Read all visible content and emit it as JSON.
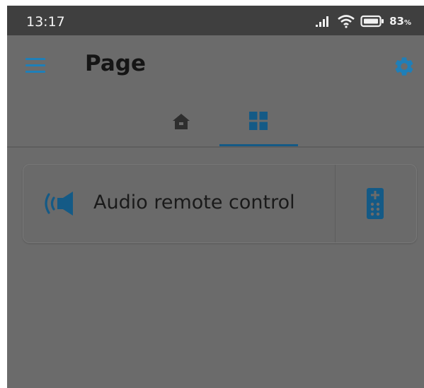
{
  "status_bar": {
    "time": "13:17",
    "battery_percent": "83",
    "battery_unit": "%",
    "icons": [
      "signal-icon",
      "wifi-icon",
      "battery-icon"
    ]
  },
  "app_bar": {
    "title": "Page",
    "left_icon": "menu-icon",
    "right_icon": "gear-icon"
  },
  "tabs": [
    {
      "icon": "home-icon",
      "selected": false
    },
    {
      "icon": "grid-icon",
      "selected": true
    }
  ],
  "items": [
    {
      "label": "Audio remote control",
      "icon": "speaker-icon",
      "action_icon": "remote-control-icon"
    }
  ],
  "colors": {
    "accent": "#1f7fb8",
    "indicator": "#145a86",
    "background": "#6b6b6b",
    "status_bar": "#3f3f3f"
  }
}
